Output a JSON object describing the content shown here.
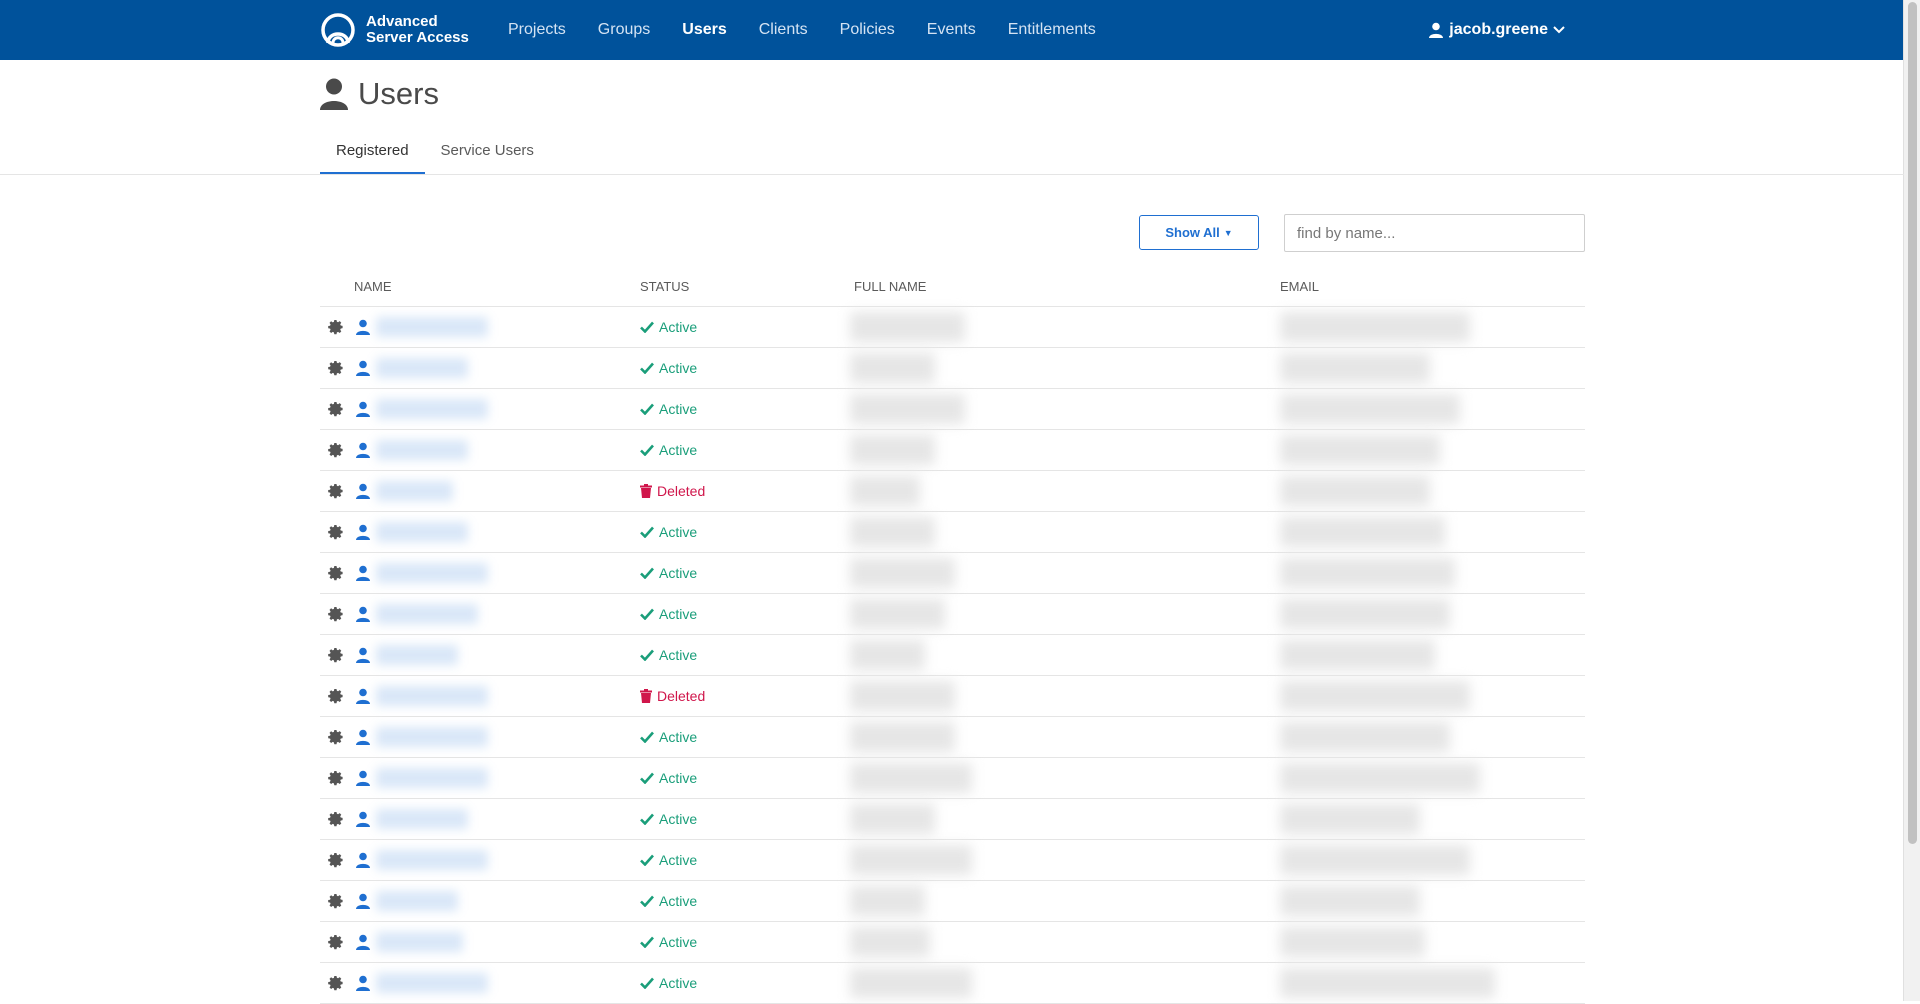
{
  "colors": {
    "brand": "#00529b",
    "accent": "#1f6fd1",
    "active": "#1a9e7a",
    "deleted": "#d0164b"
  },
  "app": {
    "name_line1": "Advanced",
    "name_line2": "Server Access",
    "logo_icon": "asa-logo-icon"
  },
  "nav": {
    "items": [
      {
        "label": "Projects",
        "active": false
      },
      {
        "label": "Groups",
        "active": false
      },
      {
        "label": "Users",
        "active": true
      },
      {
        "label": "Clients",
        "active": false
      },
      {
        "label": "Policies",
        "active": false
      },
      {
        "label": "Events",
        "active": false
      },
      {
        "label": "Entitlements",
        "active": false
      }
    ]
  },
  "user_menu": {
    "username": "jacob.greene",
    "icon": "user-icon",
    "chevron_icon": "chevron-down-icon"
  },
  "page": {
    "title": "Users",
    "title_icon": "user-icon"
  },
  "tabs": [
    {
      "label": "Registered",
      "active": true
    },
    {
      "label": "Service Users",
      "active": false
    }
  ],
  "filter": {
    "label": "Show All"
  },
  "search": {
    "placeholder": "find by name...",
    "value": ""
  },
  "table": {
    "headers": {
      "name": "NAME",
      "status": "STATUS",
      "full_name": "FULL NAME",
      "email": "EMAIL"
    },
    "rows": [
      {
        "status": "Active"
      },
      {
        "status": "Active"
      },
      {
        "status": "Active"
      },
      {
        "status": "Active"
      },
      {
        "status": "Deleted"
      },
      {
        "status": "Active"
      },
      {
        "status": "Active"
      },
      {
        "status": "Active"
      },
      {
        "status": "Active"
      },
      {
        "status": "Deleted"
      },
      {
        "status": "Active"
      },
      {
        "status": "Active"
      },
      {
        "status": "Active"
      },
      {
        "status": "Active"
      },
      {
        "status": "Active"
      },
      {
        "status": "Active"
      },
      {
        "status": "Active"
      }
    ]
  }
}
